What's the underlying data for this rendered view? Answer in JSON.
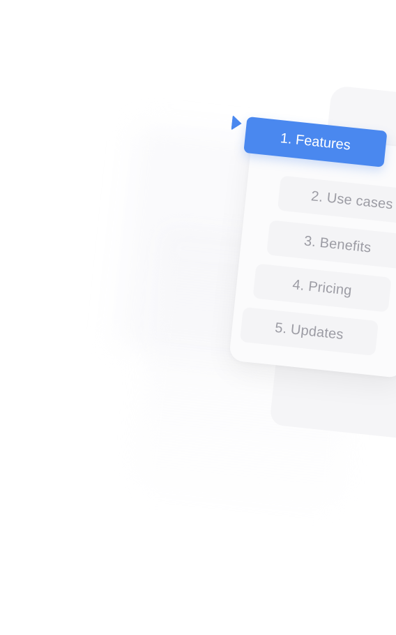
{
  "menu": {
    "items": [
      {
        "label": "1. Features",
        "active": true
      },
      {
        "label": "2. Use cases",
        "active": false
      },
      {
        "label": "3. Benefits",
        "active": false
      },
      {
        "label": "4. Pricing",
        "active": false
      },
      {
        "label": "5. Updates",
        "active": false
      }
    ],
    "accent_color": "#4a88ef",
    "pointer_icon": "triangle-right-icon"
  }
}
